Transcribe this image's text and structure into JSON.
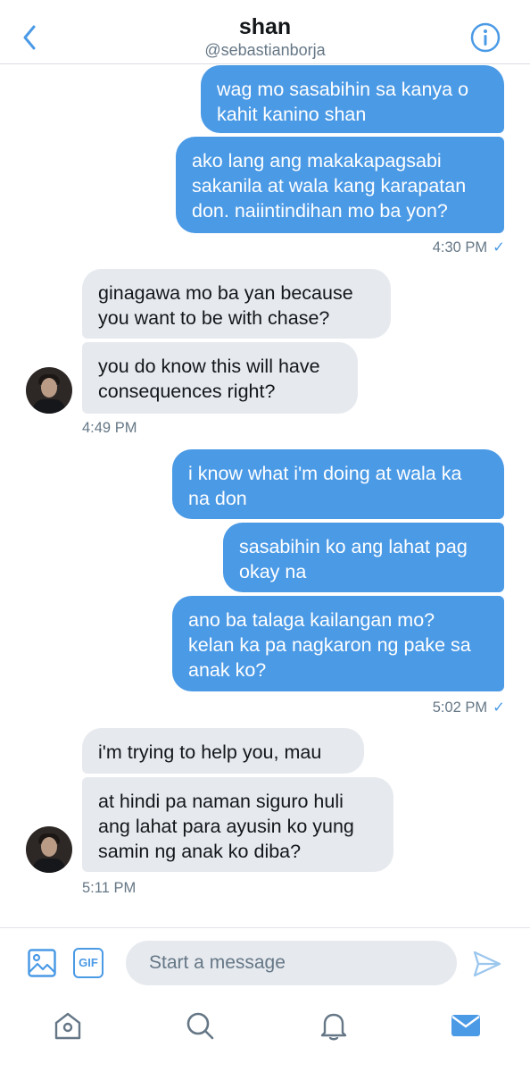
{
  "header": {
    "name": "shan",
    "handle": "@sebastianborja"
  },
  "messages": [
    {
      "direction": "outgoing",
      "text": "wag mo sasabihin sa kanya o\nkahit kanino shan"
    },
    {
      "direction": "outgoing",
      "text": "ako lang ang makakapagsabi\nsakanila at wala kang karapatan\ndon. naiintindihan mo ba yon?"
    },
    {
      "direction": "incoming",
      "text": "ginagawa mo ba yan because\nyou want to be with chase?"
    },
    {
      "direction": "incoming",
      "text": "you do know this will have\nconsequences right?"
    },
    {
      "direction": "outgoing",
      "text": "i know what i'm doing at wala ka\nna don"
    },
    {
      "direction": "outgoing",
      "text": "sasabihin ko ang lahat pag\nokay na"
    },
    {
      "direction": "outgoing",
      "text": "ano ba talaga kailangan mo?\nkelan ka pa nagkaron ng pake sa\nanak ko?"
    },
    {
      "direction": "incoming",
      "text": "i'm trying to help you, mau"
    },
    {
      "direction": "incoming",
      "text": "at hindi pa naman siguro huli\nang lahat para ayusin ko yung\nsamin ng anak ko diba?"
    }
  ],
  "timestamps": [
    "4:30 PM",
    "4:49 PM",
    "5:02 PM",
    "5:11 PM"
  ],
  "read_mark": "✓",
  "composer": {
    "placeholder": "Start a message",
    "gif_label": "GIF"
  },
  "tabs": [
    "home-icon",
    "search-icon",
    "notifications-icon",
    "messages-icon"
  ],
  "colors": {
    "accent": "#4b9ae6",
    "incoming_bubble": "#e6e9ee",
    "secondary_text": "#657786"
  }
}
